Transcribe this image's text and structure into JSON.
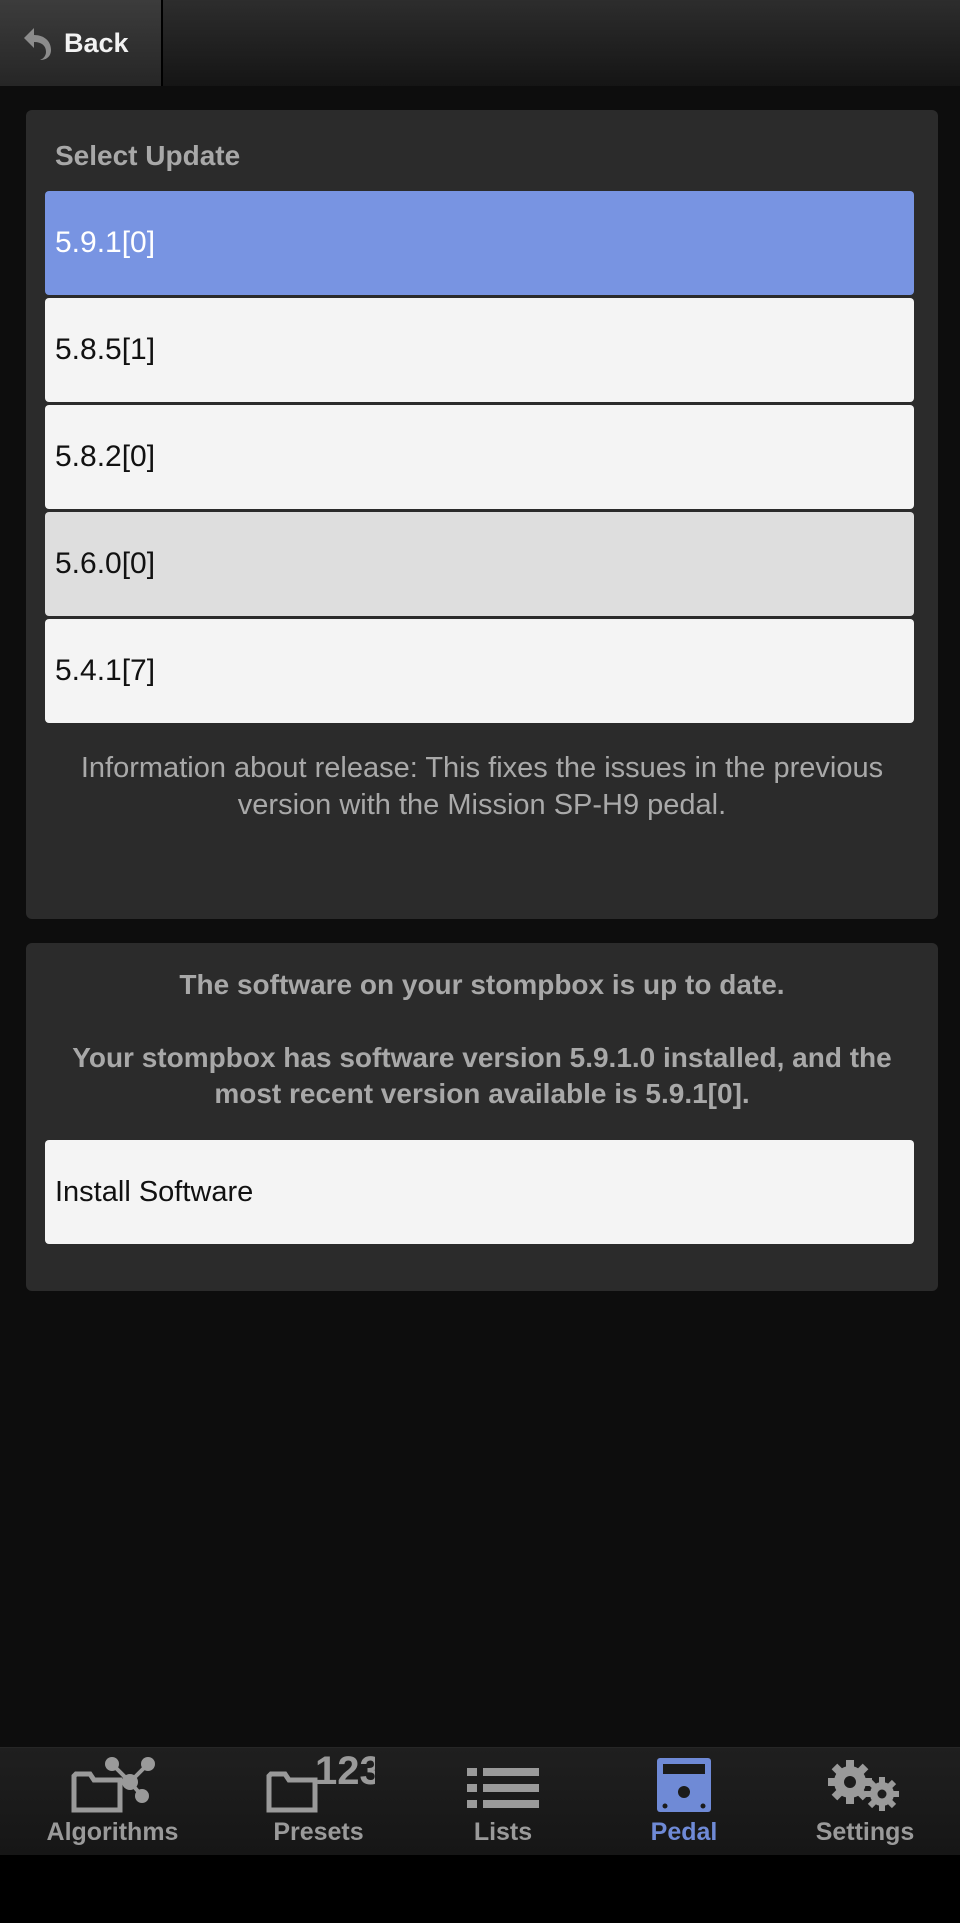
{
  "header": {
    "back_label": "Back",
    "back_icon": "undo-arrow-icon"
  },
  "updates": {
    "title": "Select Update",
    "versions": [
      {
        "label": "5.9.1[0]",
        "state": "selected"
      },
      {
        "label": "5.8.5[1]",
        "state": "normal"
      },
      {
        "label": "5.8.2[0]",
        "state": "normal"
      },
      {
        "label": "5.6.0[0]",
        "state": "highlighted"
      },
      {
        "label": "5.4.1[7]",
        "state": "normal"
      }
    ],
    "release_info": "Information about release: This fixes the issues in the previous version with the Mission SP-H9 pedal."
  },
  "status": {
    "title": "The software on your stompbox is up to date.",
    "detail": "Your stompbox has software version 5.9.1.0 installed, and the most recent version available is 5.9.1[0].",
    "install_label": "Install Software"
  },
  "tabs": [
    {
      "label": "Algorithms",
      "icon": "algorithms-icon",
      "active": false
    },
    {
      "label": "Presets",
      "icon": "presets-icon",
      "active": false
    },
    {
      "label": "Lists",
      "icon": "lists-icon",
      "active": false
    },
    {
      "label": "Pedal",
      "icon": "pedal-icon",
      "active": true
    },
    {
      "label": "Settings",
      "icon": "settings-icon",
      "active": false
    }
  ],
  "colors": {
    "accent": "#7894e2",
    "active_tab": "#6f8ad6",
    "panel": "#2b2b2b",
    "background": "#0d0d0d"
  }
}
